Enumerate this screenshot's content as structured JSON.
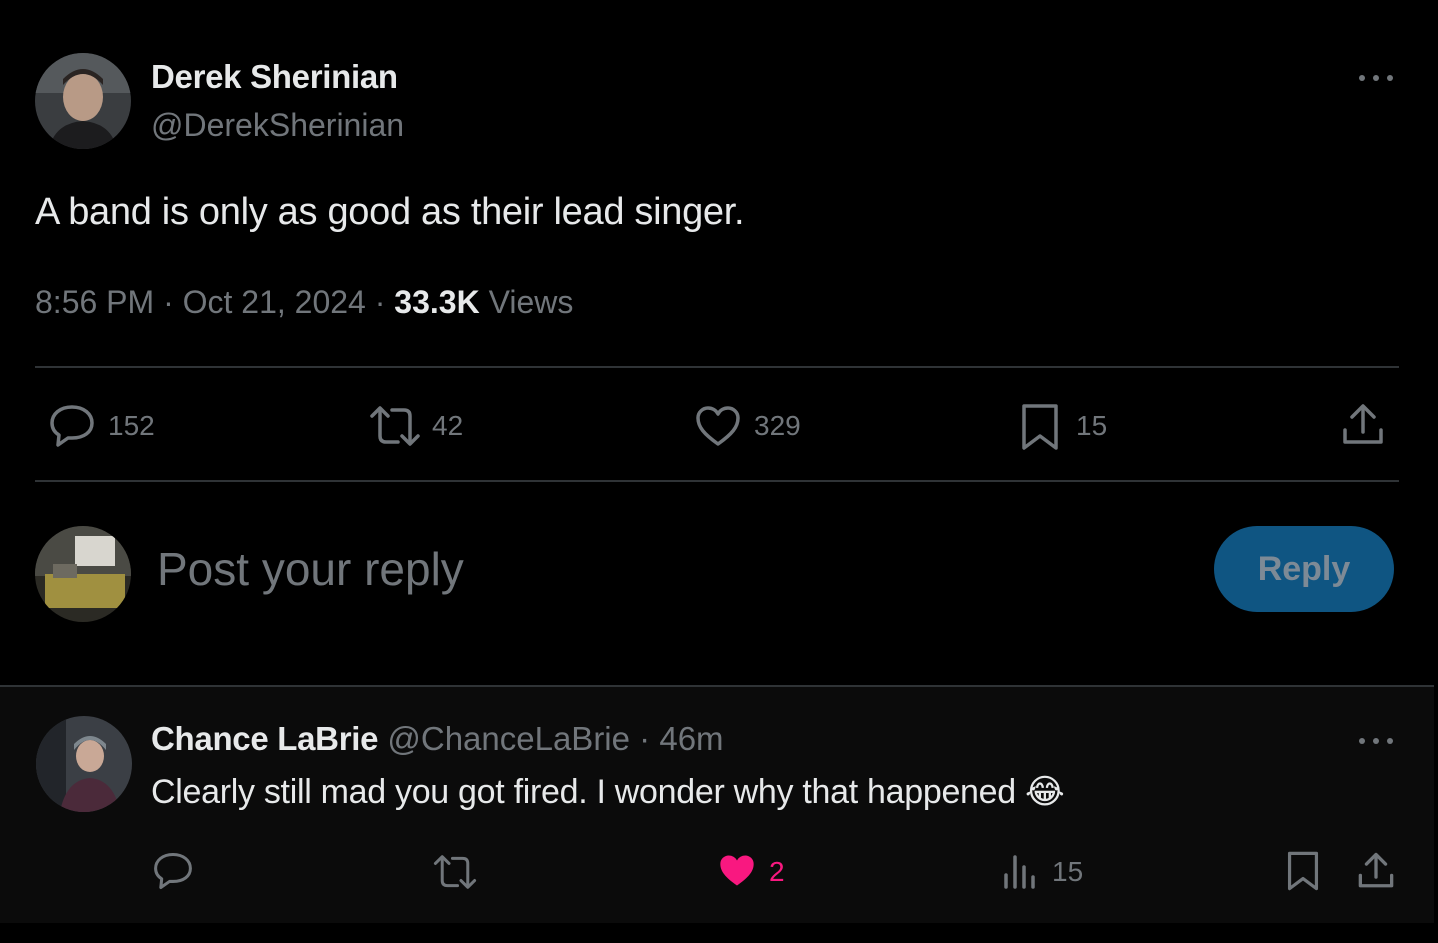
{
  "tweet": {
    "author_name": "Derek Sherinian",
    "author_handle": "@DerekSherinian",
    "text": "A band is only as good as their lead singer.",
    "time": "8:56 PM",
    "date": "Oct 21, 2024",
    "views_count": "33.3K",
    "views_label": "Views",
    "separator": "·",
    "actions": {
      "replies": "152",
      "reposts": "42",
      "likes": "329",
      "bookmarks": "15"
    }
  },
  "composer": {
    "placeholder": "Post your reply",
    "reply_button": "Reply"
  },
  "reply": {
    "author_name": "Chance LaBrie",
    "author_handle": "@ChanceLaBrie",
    "separator": "·",
    "time": "46m",
    "text": "Clearly still mad you got fired. I wonder why that happened 😂",
    "likes": "2",
    "views": "15",
    "liked": true
  },
  "colors": {
    "background": "#000000",
    "text": "#e7e9ea",
    "muted": "#71767b",
    "divider": "#2f3336",
    "reply_button_bg": "#0f5582",
    "like_active": "#f91880"
  },
  "icons": [
    "more-icon",
    "reply-icon",
    "repost-icon",
    "like-icon",
    "bookmark-icon",
    "share-icon",
    "views-icon"
  ]
}
